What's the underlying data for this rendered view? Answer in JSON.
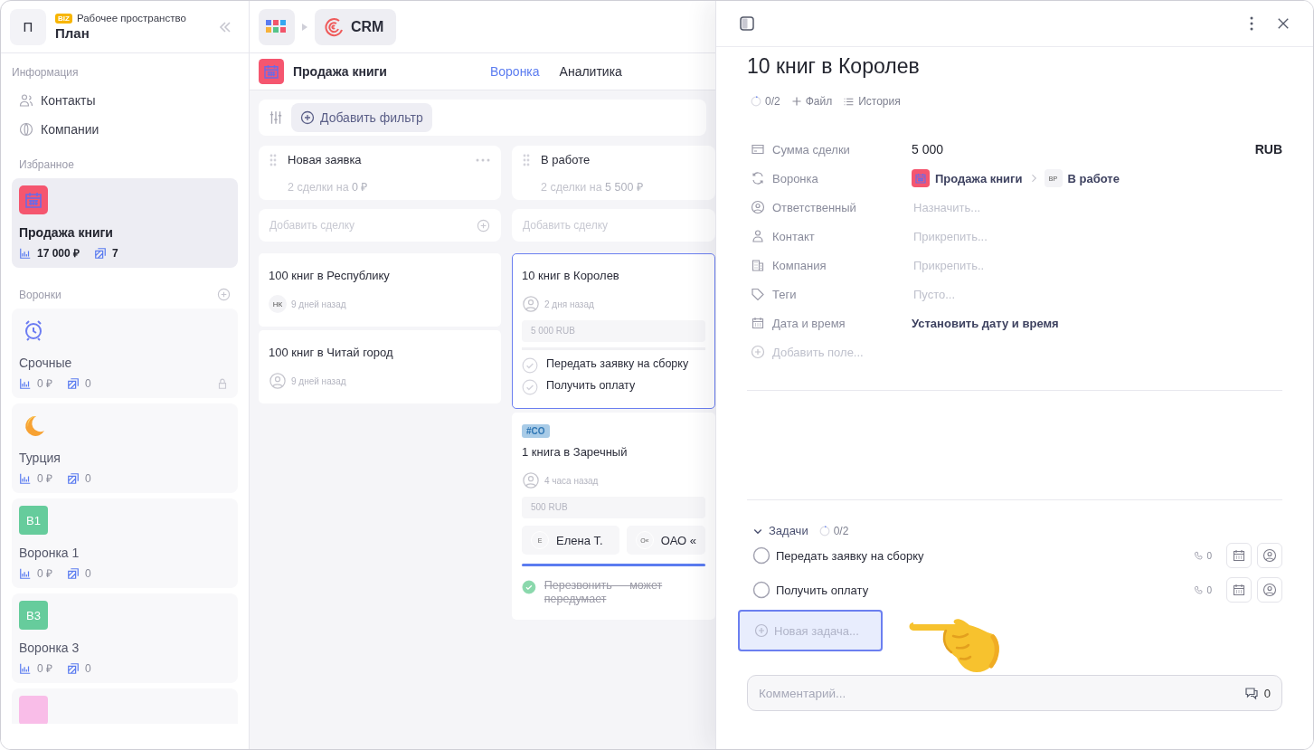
{
  "sidebar": {
    "workspace": {
      "avatar": "П",
      "badge": "BIZ",
      "label": "Рабочее пространство",
      "name": "План"
    },
    "info": {
      "heading": "Информация",
      "items": [
        {
          "kind": "contacts",
          "label": "Контакты"
        },
        {
          "kind": "companies",
          "label": "Компании"
        }
      ]
    },
    "favorites": {
      "heading": "Избранное",
      "items": [
        {
          "kind": "calendar",
          "name": "Продажа книги",
          "amount": "17 000 ₽",
          "count": "7",
          "selected": true,
          "locked": false
        }
      ]
    },
    "funnels": {
      "heading": "Воронки",
      "items": [
        {
          "kind": "alarm",
          "name": "Срочные",
          "amount": "0 ₽",
          "count": "0",
          "selected": false,
          "locked": true
        },
        {
          "kind": "moon",
          "name": "Турция",
          "amount": "0 ₽",
          "count": "0",
          "selected": false,
          "locked": false
        },
        {
          "kind": "initials",
          "initials": "В1",
          "color": "#66cc9c",
          "name": "Воронка 1",
          "amount": "0 ₽",
          "count": "0",
          "selected": false,
          "locked": false
        },
        {
          "kind": "initials",
          "initials": "В3",
          "color": "#66cc9c",
          "name": "Воронка 3",
          "amount": "0 ₽",
          "count": "0",
          "selected": false,
          "locked": false
        },
        {
          "kind": "initials",
          "color": "#f9bde8"
        }
      ]
    }
  },
  "topbar": {
    "app": "CRM"
  },
  "board": {
    "kind": "calendar",
    "title": "Продажа книги",
    "tabs": [
      {
        "label": "Воронка",
        "selected": true
      },
      {
        "label": "Аналитика",
        "selected": false
      }
    ],
    "filter": "Добавить фильтр"
  },
  "columns": [
    {
      "title": "Новая заявка",
      "summary": "2 сделки на",
      "summary_amount": "0 ₽",
      "add_placeholder": "Добавить сделку",
      "cards": [
        {
          "title": "100 книг в Республику",
          "author": {
            "kind": "initials",
            "initials": "НК"
          },
          "time": "9 дней назад",
          "selected": false
        },
        {
          "title": "100 книг в Читай город",
          "author": {
            "kind": "person"
          },
          "time": "9 дней назад",
          "selected": false
        }
      ]
    },
    {
      "title": "В работе",
      "summary": "2 сделки на",
      "summary_amount": "5 500 ₽",
      "add_placeholder": "Добавить сделку",
      "cards": [
        {
          "title": "10 книг в Королев",
          "author": {
            "kind": "person"
          },
          "time": "2 дня назад",
          "amount": "5 000 RUB",
          "tasks": [
            {
              "label": "Передать заявку на сборку",
              "done": false
            },
            {
              "label": "Получить оплату",
              "done": false
            }
          ],
          "selected": true
        },
        {
          "tag": "#CO",
          "title": "1 книга в Заречный",
          "author": {
            "kind": "person"
          },
          "time": "4 часа назад",
          "amount": "500 RUB",
          "contacts": [
            {
              "initials": "Е",
              "name": "Елена Т."
            },
            {
              "initials": "О«",
              "name": "ОАО «"
            }
          ],
          "level": 1,
          "tasks": [
            {
              "label": "Перезвонить — может передумает",
              "done": true
            }
          ],
          "selected": false
        }
      ]
    }
  ],
  "panel": {
    "title": "10 книг в Королев",
    "meta": {
      "progress": "0/2",
      "file": "Файл",
      "history": "История"
    },
    "fields": [
      {
        "kind": "amount",
        "label": "Сумма сделки",
        "value": "5 000",
        "currency": "RUB"
      },
      {
        "kind": "funnel",
        "label": "Воронка",
        "funnel": "Продажа книги",
        "stage_initials": "ВР",
        "stage": "В работе"
      },
      {
        "kind": "empty",
        "label": "Ответственный",
        "placeholder": "Назначить..."
      },
      {
        "kind": "empty",
        "label": "Контакт",
        "placeholder": "Прикрепить..."
      },
      {
        "kind": "empty",
        "label": "Компания",
        "placeholder": "Прикрепить.."
      },
      {
        "kind": "empty",
        "label": "Теги",
        "placeholder": "Пусто..."
      },
      {
        "kind": "link",
        "label": "Дата и время",
        "value": "Установить дату и время"
      }
    ],
    "add_field": "Добавить поле...",
    "tasks": {
      "heading": "Задачи",
      "expanded": true,
      "progress": "0/2",
      "items": [
        {
          "label": "Передать заявку на сборку",
          "done": false,
          "calls": "0"
        },
        {
          "label": "Получить оплату",
          "done": false,
          "calls": "0"
        }
      ],
      "new_placeholder": "Новая задача..."
    },
    "comment": {
      "placeholder": "Комментарий...",
      "count": "0"
    }
  }
}
